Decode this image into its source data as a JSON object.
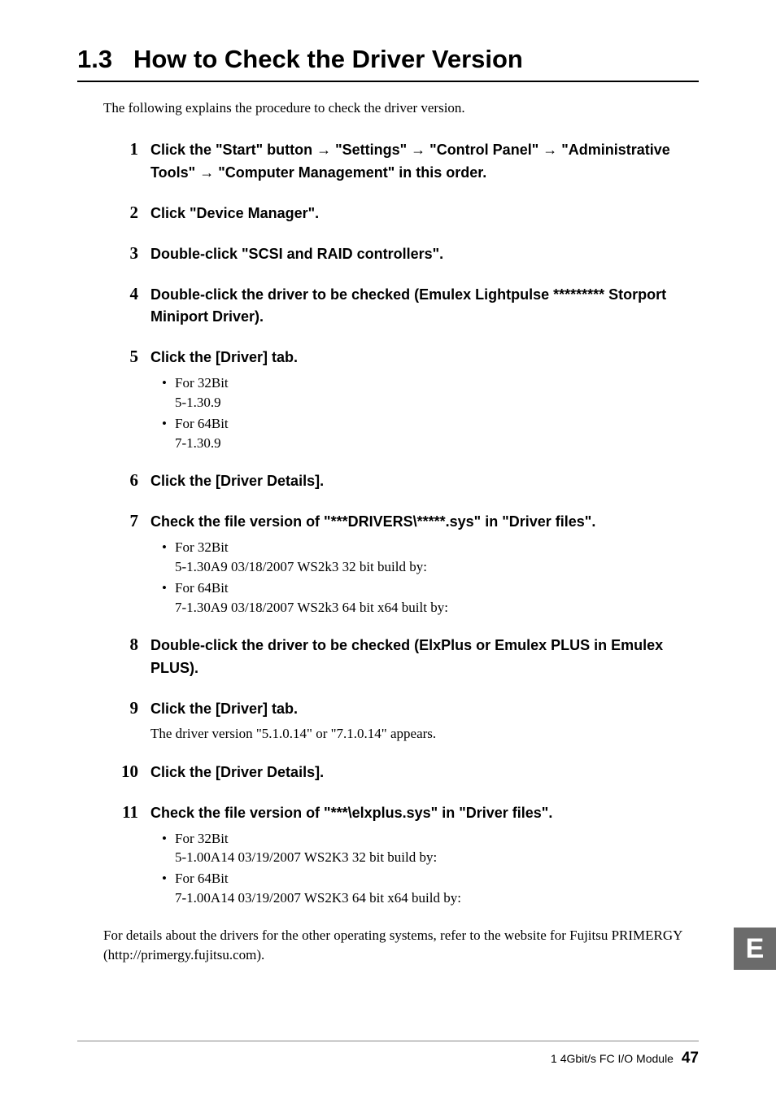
{
  "section": {
    "number": "1.3",
    "title": "How to Check the Driver Version"
  },
  "intro": "The following explains the procedure to check the driver version.",
  "steps": [
    {
      "num": "1",
      "title_parts": [
        "Click the \"Start\" button ",
        "→",
        " \"Settings\" ",
        "→",
        " \"Control Panel\" ",
        "→",
        " \"Administrative Tools\" ",
        "→",
        " \"Computer Management\" in this order."
      ]
    },
    {
      "num": "2",
      "title": "Click \"Device Manager\"."
    },
    {
      "num": "3",
      "title": "Double-click \"SCSI and RAID controllers\"."
    },
    {
      "num": "4",
      "title": "Double-click the driver to be checked (Emulex Lightpulse ********* Storport Miniport Driver)."
    },
    {
      "num": "5",
      "title": "Click the [Driver] tab.",
      "bullets": [
        {
          "label": "For 32Bit",
          "value": "5-1.30.9"
        },
        {
          "label": "For 64Bit",
          "value": "7-1.30.9"
        }
      ]
    },
    {
      "num": "6",
      "title": "Click the [Driver Details]."
    },
    {
      "num": "7",
      "title": "Check the file version of \"***DRIVERS\\*****.sys\" in \"Driver files\".",
      "bullets": [
        {
          "label": "For 32Bit",
          "value": "5-1.30A9 03/18/2007 WS2k3 32 bit build by:"
        },
        {
          "label": "For 64Bit",
          "value": "7-1.30A9 03/18/2007 WS2k3 64 bit x64 built by:"
        }
      ]
    },
    {
      "num": "8",
      "title": "Double-click the driver to be checked (ElxPlus or Emulex PLUS in Emulex PLUS)."
    },
    {
      "num": "9",
      "title": "Click the [Driver] tab.",
      "body": "The driver version \"5.1.0.14\" or \"7.1.0.14\" appears."
    },
    {
      "num": "10",
      "title": "Click the [Driver Details]."
    },
    {
      "num": "11",
      "title": "Check the file version of \"***\\elxplus.sys\" in \"Driver files\".",
      "bullets": [
        {
          "label": "For 32Bit",
          "value": "5-1.00A14 03/19/2007 WS2K3 32 bit build by:"
        },
        {
          "label": "For 64Bit",
          "value": "7-1.00A14 03/19/2007 WS2K3 64 bit x64 build by:"
        }
      ]
    }
  ],
  "closing": "For details about the drivers for the other operating systems, refer to the website for Fujitsu PRIMERGY (http://primergy.fujitsu.com).",
  "lang_tab": "E",
  "footer": {
    "label": "1  4Gbit/s FC I/O Module",
    "page": "47"
  }
}
